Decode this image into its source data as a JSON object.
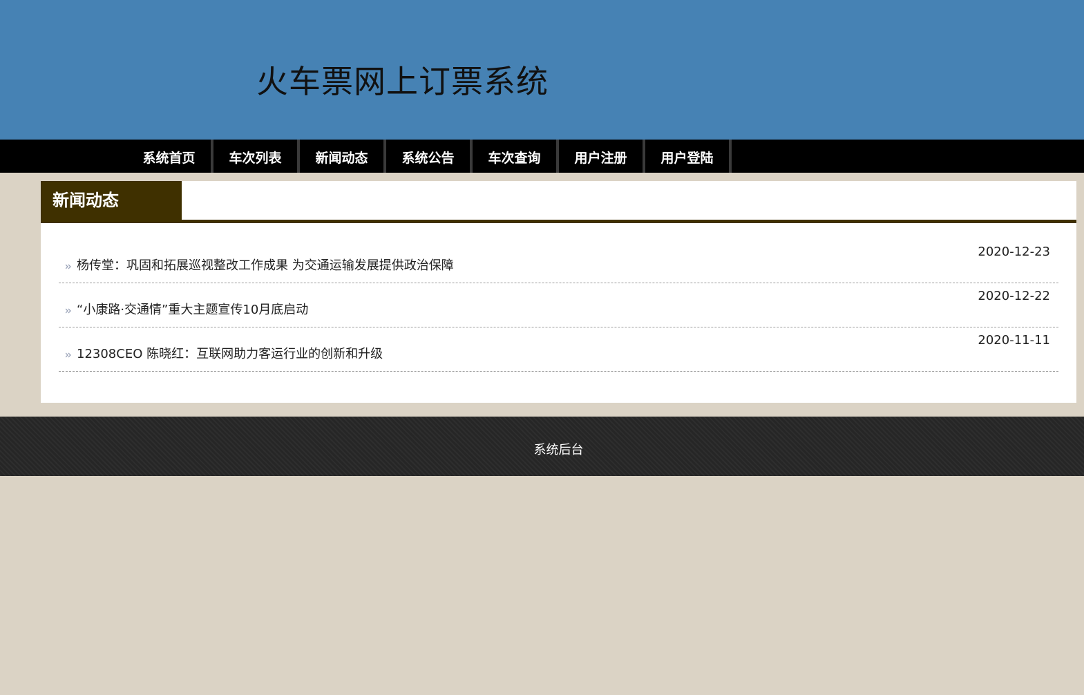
{
  "header": {
    "site_title": "火车票网上订票系统"
  },
  "nav": {
    "items": [
      {
        "label": "系统首页"
      },
      {
        "label": "车次列表"
      },
      {
        "label": "新闻动态"
      },
      {
        "label": "系统公告"
      },
      {
        "label": "车次查询"
      },
      {
        "label": "用户注册"
      },
      {
        "label": "用户登陆"
      }
    ]
  },
  "news_panel": {
    "heading": "新闻动态",
    "bullet_icon": "double-chevron-right-icon",
    "items": [
      {
        "title": "杨传堂：巩固和拓展巡视整改工作成果 为交通运输发展提供政治保障",
        "date": "2020-12-23"
      },
      {
        "title": "“小康路·交通情”重大主题宣传10月底启动",
        "date": "2020-12-22"
      },
      {
        "title": "12308CEO 陈晓红：互联网助力客运行业的创新和升级",
        "date": "2020-11-11"
      }
    ]
  },
  "footer": {
    "admin_link": "系统后台"
  },
  "colors": {
    "header_bg": "#4682b4",
    "nav_bg": "#000000",
    "page_bg": "#dbd3c5",
    "panel_accent": "#3f3000",
    "footer_bg": "#262626"
  }
}
